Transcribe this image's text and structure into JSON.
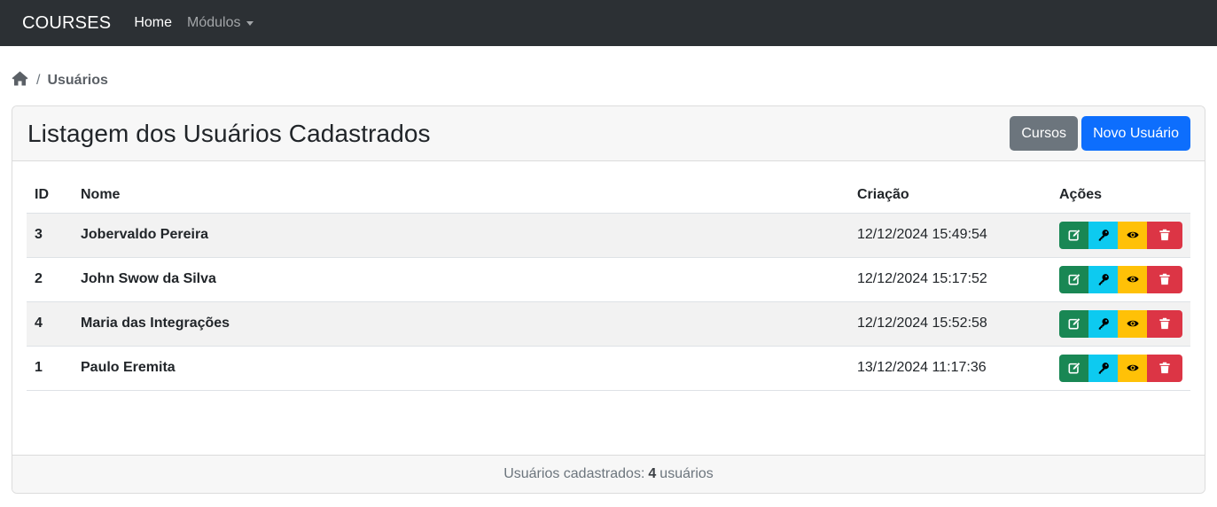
{
  "navbar": {
    "brand": "COURSES",
    "links": [
      {
        "label": "Home"
      },
      {
        "label": "Módulos"
      }
    ]
  },
  "breadcrumb": {
    "separator": "/",
    "current": "Usuários"
  },
  "card": {
    "title": "Listagem dos Usuários Cadastrados",
    "buttons": {
      "courses": "Cursos",
      "new_user": "Novo Usuário"
    }
  },
  "table": {
    "headers": {
      "id": "ID",
      "name": "Nome",
      "created": "Criação",
      "actions": "Ações"
    },
    "rows": [
      {
        "id": "3",
        "name": "Jobervaldo Pereira",
        "created": "12/12/2024 15:49:54"
      },
      {
        "id": "2",
        "name": "John Swow da Silva",
        "created": "12/12/2024 15:17:52"
      },
      {
        "id": "4",
        "name": "Maria das Integrações",
        "created": "12/12/2024 15:52:58"
      },
      {
        "id": "1",
        "name": "Paulo Eremita",
        "created": "13/12/2024 11:17:36"
      }
    ],
    "action_icons": [
      "edit-icon",
      "key-icon",
      "eye-icon",
      "trash-icon"
    ]
  },
  "footer": {
    "prefix": "Usuários cadastrados:",
    "count": "4",
    "suffix": "usuários"
  },
  "colors": {
    "navbar": "#2c3034",
    "primary": "#0d6efd",
    "secondary": "#6c757d",
    "success": "#198754",
    "info": "#0dcaf0",
    "warning": "#ffc107",
    "danger": "#dc3545"
  }
}
